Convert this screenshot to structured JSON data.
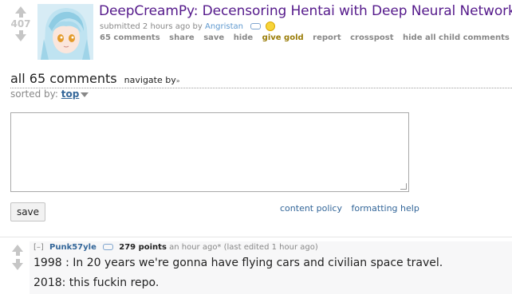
{
  "post": {
    "score": "407",
    "title": "DeepCreamPy: Decensoring Hentai with Deep Neural Networks",
    "submitted_prefix": "submitted 2 hours ago by",
    "author": "Angristan",
    "actions": [
      "65 comments",
      "share",
      "save",
      "hide",
      "give gold",
      "report",
      "crosspost",
      "hide all child comments"
    ]
  },
  "comments_section": {
    "count_label": "all 65 comments",
    "navigate_label": "navigate by",
    "sorted_prefix": "sorted by:",
    "sort_value": "top"
  },
  "composer": {
    "save_label": "save",
    "content_policy": "content policy",
    "formatting_help": "formatting help"
  },
  "comment": {
    "expand": "[–]",
    "author": "Punk57yle",
    "points": "279 points",
    "meta": "an hour ago* (last edited 1 hour ago)",
    "line1": "1998 : In 20 years we're gonna have flying cars and civilian space travel.",
    "line2": "2018: this fuckin repo."
  }
}
